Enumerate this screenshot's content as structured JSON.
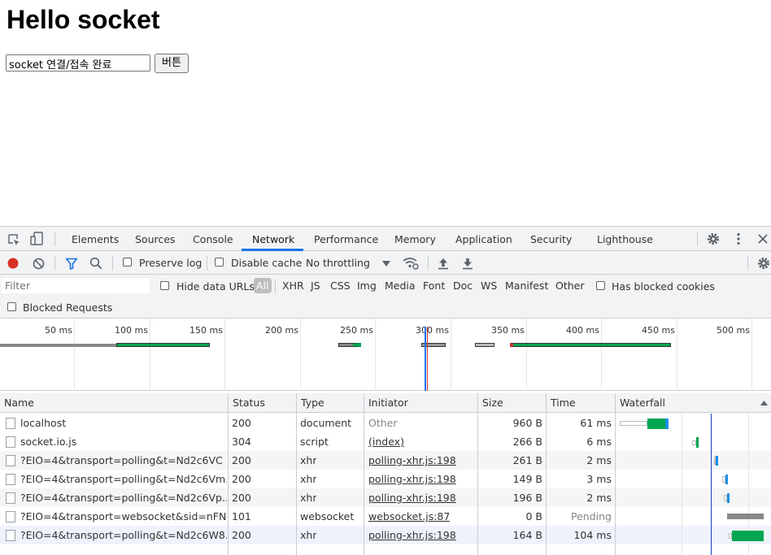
{
  "page": {
    "heading": "Hello socket",
    "input_value": "socket 연결/접속 완료",
    "button_label": "버튼"
  },
  "devtools": {
    "tabs": [
      "Elements",
      "Sources",
      "Console",
      "Network",
      "Performance",
      "Memory",
      "Application",
      "Security",
      "Lighthouse"
    ],
    "active_tab": "Network",
    "toolbar": {
      "preserve_log": "Preserve log",
      "disable_cache": "Disable cache",
      "throttling": "No throttling"
    },
    "filter": {
      "placeholder": "Filter",
      "hide_data_urls": "Hide data URLs",
      "types": [
        "All",
        "XHR",
        "JS",
        "CSS",
        "Img",
        "Media",
        "Font",
        "Doc",
        "WS",
        "Manifest",
        "Other"
      ],
      "selected_type": "All",
      "has_blocked_cookies": "Has blocked cookies",
      "blocked_requests": "Blocked Requests"
    },
    "overview": {
      "ticks": [
        "50 ms",
        "100 ms",
        "150 ms",
        "200 ms",
        "250 ms",
        "300 ms",
        "350 ms",
        "400 ms",
        "450 ms",
        "500 ms"
      ]
    },
    "table": {
      "columns": [
        "Name",
        "Status",
        "Type",
        "Initiator",
        "Size",
        "Time",
        "Waterfall"
      ],
      "rows": [
        {
          "name": "localhost",
          "status": "200",
          "type": "document",
          "initiator": "Other",
          "size": "960 B",
          "time": "61 ms"
        },
        {
          "name": "socket.io.js",
          "status": "304",
          "type": "script",
          "initiator": "(index)",
          "size": "266 B",
          "time": "6 ms"
        },
        {
          "name": "?EIO=4&transport=polling&t=Nd2c6VC",
          "status": "200",
          "type": "xhr",
          "initiator": "polling-xhr.js:198",
          "size": "261 B",
          "time": "2 ms"
        },
        {
          "name": "?EIO=4&transport=polling&t=Nd2c6Vm...",
          "status": "200",
          "type": "xhr",
          "initiator": "polling-xhr.js:198",
          "size": "149 B",
          "time": "3 ms"
        },
        {
          "name": "?EIO=4&transport=polling&t=Nd2c6Vp...",
          "status": "200",
          "type": "xhr",
          "initiator": "polling-xhr.js:198",
          "size": "196 B",
          "time": "2 ms"
        },
        {
          "name": "?EIO=4&transport=websocket&sid=nFN...",
          "status": "101",
          "type": "websocket",
          "initiator": "websocket.js:87",
          "size": "0 B",
          "time": "Pending"
        },
        {
          "name": "?EIO=4&transport=polling&t=Nd2c6W8...",
          "status": "200",
          "type": "xhr",
          "initiator": "polling-xhr.js:198",
          "size": "164 B",
          "time": "104 ms"
        }
      ]
    }
  },
  "colors": {
    "accent": "#1a73e8",
    "record": "#d93025",
    "waiting": "#00a651",
    "pending": "#888888"
  }
}
